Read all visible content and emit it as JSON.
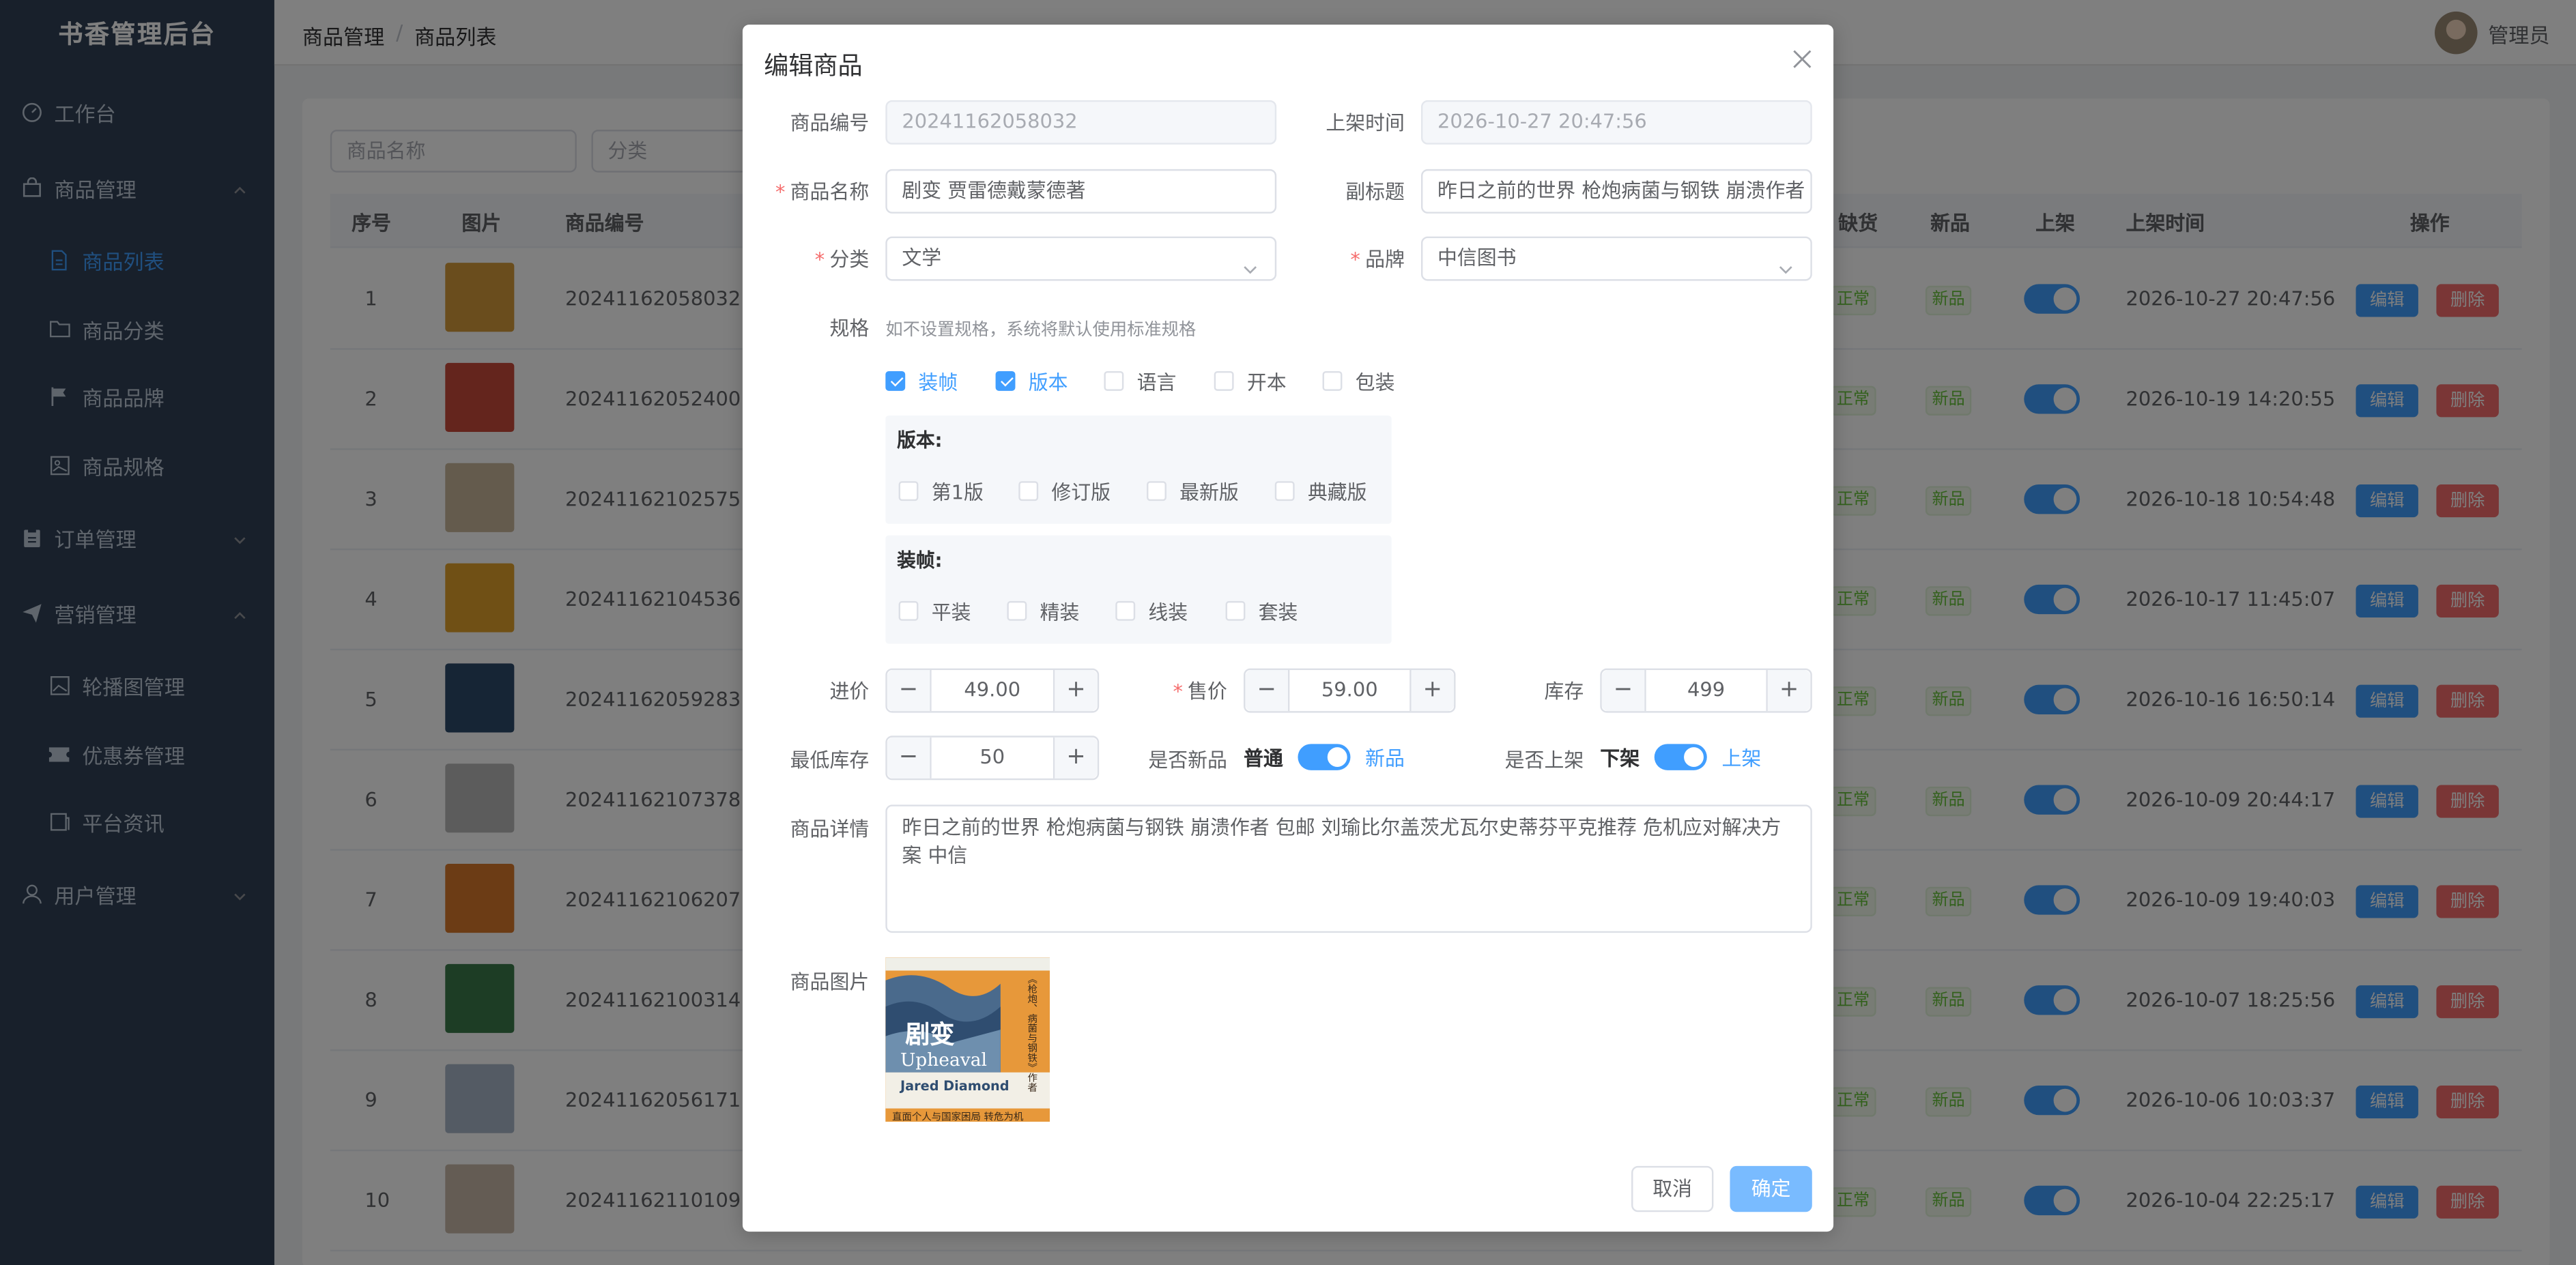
{
  "app": {
    "title": "书香管理后台"
  },
  "breadcrumb": [
    "商品管理",
    "商品列表"
  ],
  "user": {
    "name": "管理员"
  },
  "sidebar": {
    "items": [
      {
        "label": "工作台",
        "icon": "dashboard-icon"
      },
      {
        "label": "商品管理",
        "icon": "bag-icon"
      },
      {
        "label": "商品列表",
        "icon": "document-icon"
      },
      {
        "label": "商品分类",
        "icon": "folder-icon"
      },
      {
        "label": "商品品牌",
        "icon": "flag-icon"
      },
      {
        "label": "商品规格",
        "icon": "image-icon"
      },
      {
        "label": "订单管理",
        "icon": "clipboard-icon"
      },
      {
        "label": "营销管理",
        "icon": "paper-plane-icon"
      },
      {
        "label": "轮播图管理",
        "icon": "picture-icon"
      },
      {
        "label": "优惠券管理",
        "icon": "ticket-icon"
      },
      {
        "label": "平台资讯",
        "icon": "news-icon"
      },
      {
        "label": "用户管理",
        "icon": "user-icon"
      }
    ]
  },
  "filters": {
    "name_placeholder": "商品名称",
    "category_placeholder": "分类"
  },
  "table": {
    "headers": {
      "index": "序号",
      "image": "图片",
      "code": "商品编号",
      "stock_status": "缺货",
      "new": "新品",
      "on_shelf": "上架",
      "time": "上架时间",
      "ops": "操作"
    },
    "status_tag": "正常",
    "new_tag": "新品",
    "edit_label": "编辑",
    "delete_label": "删除",
    "rows": [
      {
        "index": "1",
        "code": "20241162058032",
        "time": "2026-10-27 20:47:56"
      },
      {
        "index": "2",
        "code": "20241162052400",
        "time": "2026-10-19 14:20:55"
      },
      {
        "index": "3",
        "code": "20241162102575",
        "time": "2026-10-18 10:54:48"
      },
      {
        "index": "4",
        "code": "20241162104536",
        "time": "2026-10-17 11:45:07"
      },
      {
        "index": "5",
        "code": "20241162059283",
        "time": "2026-10-16 16:50:14"
      },
      {
        "index": "6",
        "code": "20241162107378",
        "time": "2026-10-09 20:44:17"
      },
      {
        "index": "7",
        "code": "20241162106207",
        "time": "2026-10-09 19:40:03"
      },
      {
        "index": "8",
        "code": "20241162100314",
        "time": "2026-10-07 18:25:56"
      },
      {
        "index": "9",
        "code": "20241162056171",
        "time": "2026-10-06 10:03:37"
      },
      {
        "index": "10",
        "code": "20241162110109",
        "time": "2026-10-04 22:25:17"
      }
    ]
  },
  "dialog": {
    "title": "编辑商品",
    "labels": {
      "code": "商品编号",
      "on_time": "上架时间",
      "name": "商品名称",
      "subtitle": "副标题",
      "category": "分类",
      "brand": "品牌",
      "spec": "规格",
      "cost": "进价",
      "price": "售价",
      "stock": "库存",
      "min_stock": "最低库存",
      "is_new": "是否新品",
      "is_on": "是否上架",
      "detail": "商品详情",
      "image": "商品图片"
    },
    "values": {
      "code": "20241162058032",
      "on_time": "2026-10-27 20:47:56",
      "name": "剧变 贾雷德戴蒙德著",
      "subtitle": "昨日之前的世界 枪炮病菌与钢铁 崩溃作者",
      "category": "文学",
      "brand": "中信图书",
      "cost": "49.00",
      "price": "59.00",
      "stock": "499",
      "min_stock": "50",
      "detail": "昨日之前的世界 枪炮病菌与钢铁 崩溃作者 包邮 刘瑜比尔盖茨尤瓦尔史蒂芬平克推荐 危机应对解决方案 中信"
    },
    "spec_hint": "如不设置规格，系统将默认使用标准规格",
    "spec_options": [
      {
        "label": "装帧",
        "checked": true
      },
      {
        "label": "版本",
        "checked": true
      },
      {
        "label": "语言",
        "checked": false
      },
      {
        "label": "开本",
        "checked": false
      },
      {
        "label": "包装",
        "checked": false
      }
    ],
    "version_group": {
      "title": "版本:",
      "options": [
        "第1版",
        "修订版",
        "最新版",
        "典藏版"
      ]
    },
    "binding_group": {
      "title": "装帧:",
      "options": [
        "平装",
        "精装",
        "线装",
        "套装"
      ]
    },
    "new_switch": {
      "off_label": "普通",
      "on_label": "新品",
      "value": true
    },
    "shelf_switch": {
      "off_label": "下架",
      "on_label": "上架",
      "value": true
    },
    "cover": {
      "title_cn": "剧变",
      "title_en": "Upheaval",
      "author": "Jared Diamond",
      "side_text": "《枪炮、病菌与钢铁》作者",
      "bottom_text": "直面个人与国家困局 转危为机"
    },
    "cancel_label": "取消",
    "ok_label": "确定"
  },
  "colors": {
    "primary": "#409eff",
    "danger": "#f56c6c",
    "success": "#67c23a",
    "sidebar_bg": "#304156"
  }
}
